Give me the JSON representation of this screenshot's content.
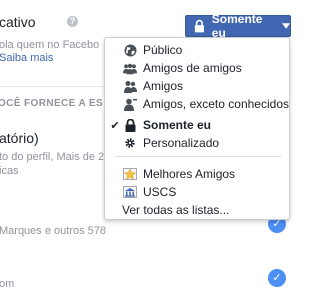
{
  "background": {
    "title": "cativo",
    "description": "ola quem no Facebo",
    "learn_more": "Saiba mais",
    "section_heading": "OCÊ FORNECE A ES",
    "item_title": "atório)",
    "item_sub1": "to do perfil, Mais de 2",
    "item_sub2": "icas",
    "item_names": "Marques e outros 578",
    "item_om": "om"
  },
  "privacy_button": {
    "label": "Somente eu",
    "icon": "lock-icon",
    "color": "#4267b2"
  },
  "dropdown": {
    "items": [
      {
        "label": "Público",
        "icon": "globe-icon",
        "selected": false
      },
      {
        "label": "Amigos de amigos",
        "icon": "friends-of-friends-icon",
        "selected": false
      },
      {
        "label": "Amigos",
        "icon": "friends-icon",
        "selected": false
      },
      {
        "label": "Amigos, exceto conhecidos",
        "icon": "friends-except-icon",
        "selected": false
      },
      {
        "label": "Somente eu",
        "icon": "lock-icon",
        "selected": true
      },
      {
        "label": "Personalizado",
        "icon": "gear-icon",
        "selected": false
      }
    ],
    "lists": [
      {
        "label": "Melhores Amigos",
        "icon": "star-list-icon"
      },
      {
        "label": "USCS",
        "icon": "school-list-icon"
      }
    ],
    "see_all": "Ver todas as listas..."
  }
}
